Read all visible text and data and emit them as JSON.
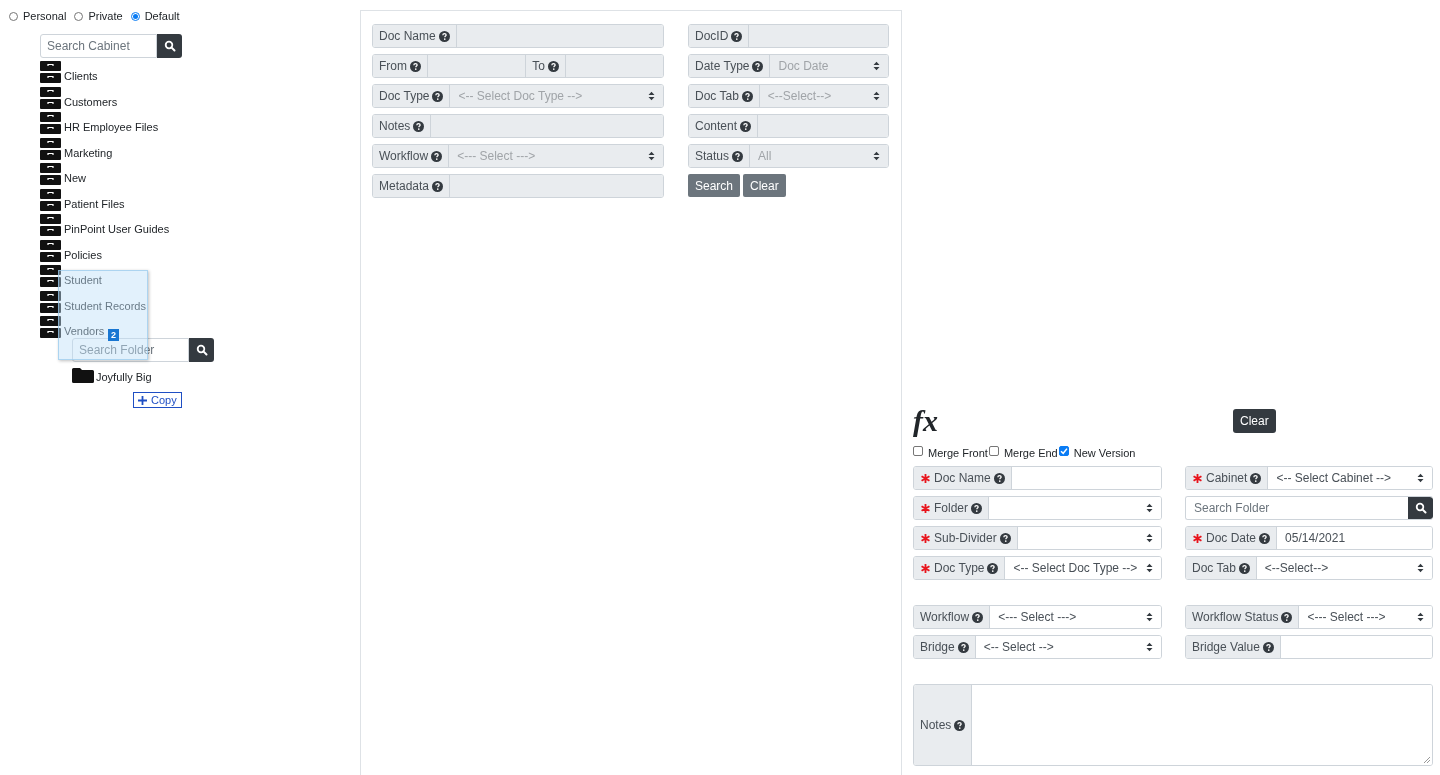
{
  "scope": [
    {
      "label": "Personal",
      "selected": false
    },
    {
      "label": "Private",
      "selected": false
    },
    {
      "label": "Default",
      "selected": true
    }
  ],
  "cabinet_search": {
    "placeholder": "Search Cabinet"
  },
  "cabinets": [
    {
      "name": "Clients"
    },
    {
      "name": "Customers"
    },
    {
      "name": "HR Employee Files"
    },
    {
      "name": "Marketing"
    },
    {
      "name": "New"
    },
    {
      "name": "Patient Files"
    },
    {
      "name": "PinPoint User Guides"
    },
    {
      "name": "Policies"
    },
    {
      "name": "Student"
    },
    {
      "name": "Student Records"
    },
    {
      "name": "Vendors"
    }
  ],
  "drag": {
    "count": "2"
  },
  "folder_search": {
    "placeholder": "Search Folder"
  },
  "folders": [
    {
      "name": "Joyfully Big"
    }
  ],
  "copy_button": {
    "label": "Copy"
  },
  "search_form": {
    "fields": [
      {
        "kind": "text",
        "label": "Doc Name",
        "disabled": true
      },
      {
        "kind": "text",
        "label": "DocID",
        "disabled": true
      },
      {
        "kind": "range",
        "label": "From",
        "label_2": "To",
        "disabled": true
      },
      {
        "kind": "select",
        "label": "Date Type",
        "value": "Doc Date",
        "disabled": true
      },
      {
        "kind": "select",
        "label": "Doc Type",
        "value": "<-- Select Doc Type -->",
        "disabled": true
      },
      {
        "kind": "select",
        "label": "Doc Tab",
        "value": "<--Select-->",
        "disabled": true
      },
      {
        "kind": "text",
        "label": "Notes",
        "disabled": true
      },
      {
        "kind": "text",
        "label": "Content",
        "disabled": true
      },
      {
        "kind": "select",
        "label": "Workflow",
        "value": "<--- Select --->",
        "disabled": true
      },
      {
        "kind": "select",
        "label": "Status",
        "value": "All",
        "disabled": true
      },
      {
        "kind": "text",
        "label": "Metadata",
        "disabled": true
      }
    ],
    "buttons": [
      "Search",
      "Clear"
    ]
  },
  "index_form": {
    "fx": "fx",
    "clear_button": "Clear",
    "options": [
      {
        "label": "Merge Front",
        "checked": false
      },
      {
        "label": "Merge End",
        "checked": false
      },
      {
        "label": "New Version",
        "checked": true
      }
    ],
    "groups": [
      [
        {
          "kind": "text",
          "label": "Doc Name",
          "required": true,
          "disabled": false
        },
        {
          "kind": "select",
          "label": "Cabinet",
          "required": true,
          "value": "<-- Select Cabinet -->",
          "disabled": false
        },
        {
          "kind": "select",
          "label": "Folder",
          "required": true,
          "disabled": false
        },
        {
          "kind": "search",
          "placeholder": "Search Folder",
          "disabled": false
        },
        {
          "kind": "select",
          "label": "Sub-Divider",
          "required": true,
          "disabled": false
        },
        {
          "kind": "text",
          "label": "Doc Date",
          "required": true,
          "value": "05/14/2021",
          "disabled": false
        },
        {
          "kind": "select",
          "label": "Doc Type",
          "required": true,
          "value": "<-- Select Doc Type -->",
          "disabled": false
        },
        {
          "kind": "select",
          "label": "Doc Tab",
          "required": false,
          "value": "<--Select-->",
          "disabled": false
        }
      ],
      [
        {
          "kind": "select",
          "label": "Workflow",
          "required": false,
          "value": "<--- Select --->",
          "disabled": false
        },
        {
          "kind": "select",
          "label": "Workflow Status",
          "required": false,
          "value": "<--- Select --->",
          "disabled": false
        },
        {
          "kind": "select",
          "label": "Bridge",
          "required": false,
          "value": "<-- Select -->",
          "disabled": false
        },
        {
          "kind": "text",
          "label": "Bridge Value",
          "required": false,
          "disabled": false
        }
      ],
      [
        {
          "kind": "textarea",
          "label": "Notes",
          "required": false,
          "disabled": false
        }
      ]
    ]
  }
}
